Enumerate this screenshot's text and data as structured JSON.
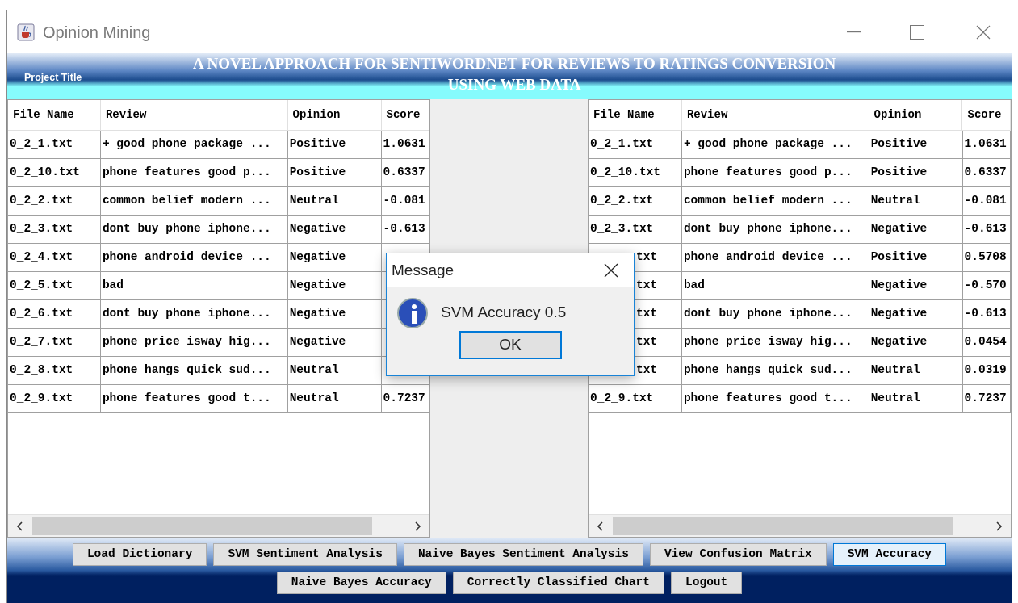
{
  "window": {
    "title": "Opinion Mining"
  },
  "header": {
    "label": "Project Title",
    "title_lines": [
      "A NOVEL APPROACH FOR SENTIWORDNET FOR REVIEWS TO RATINGS CONVERSION",
      "USING WEB DATA"
    ]
  },
  "tables": [
    {
      "columns": [
        "File Name",
        "Review",
        "Opinion",
        "Score"
      ],
      "rows": [
        {
          "file_name": "0_2_1.txt",
          "review": "+ good phone package ...",
          "opinion": "Positive",
          "score": "1.0631",
          "covered": false
        },
        {
          "file_name": "0_2_10.txt",
          "review": "phone features good p...",
          "opinion": "Positive",
          "score": "0.6337",
          "covered": false
        },
        {
          "file_name": "0_2_2.txt",
          "review": "common belief modern ...",
          "opinion": "Neutral",
          "score": "-0.081",
          "covered": false
        },
        {
          "file_name": "0_2_3.txt",
          "review": "dont buy phone iphone...",
          "opinion": "Negative",
          "score": "-0.613",
          "covered": false
        },
        {
          "file_name": "0_2_4.txt",
          "review": "phone android device ...",
          "opinion": "Negative",
          "covered": false
        },
        {
          "file_name": "0_2_5.txt",
          "review": "bad",
          "opinion": "Negative",
          "covered": false
        },
        {
          "file_name": "0_2_6.txt",
          "review": "dont buy phone iphone...",
          "opinion": "Negative",
          "covered": false
        },
        {
          "file_name": "0_2_7.txt",
          "review": "phone price isway hig...",
          "opinion": "Negative",
          "covered": false
        },
        {
          "file_name": "0_2_8.txt",
          "review": "phone hangs quick sud...",
          "opinion": "Neutral",
          "covered": false
        },
        {
          "file_name": "0_2_9.txt",
          "review": "phone features good t...",
          "opinion": "Neutral",
          "score": "0.7237",
          "covered": false
        }
      ]
    },
    {
      "columns": [
        "File Name",
        "Review",
        "Opinion",
        "Score"
      ],
      "rows": [
        {
          "file_name": "0_2_1.txt",
          "review": "+ good phone package ...",
          "opinion": "Positive",
          "score": "1.0631",
          "covered": false
        },
        {
          "file_name": "0_2_10.txt",
          "review": "phone features good p...",
          "opinion": "Positive",
          "score": "0.6337",
          "covered": false
        },
        {
          "file_name": "0_2_2.txt",
          "review": "common belief modern ...",
          "opinion": "Neutral",
          "score": "-0.081",
          "covered": false
        },
        {
          "file_name": "0_2_3.txt",
          "review": "dont buy phone iphone...",
          "opinion": "Negative",
          "score": "-0.613",
          "covered": false
        },
        {
          "file_name": "txt",
          "review": "phone android device ...",
          "opinion": "Positive",
          "score": "0.5708",
          "covered": true
        },
        {
          "file_name": "txt",
          "review": "bad",
          "opinion": "Negative",
          "score": "-0.570",
          "covered": true
        },
        {
          "file_name": "txt",
          "review": "dont buy phone iphone...",
          "opinion": "Negative",
          "score": "-0.613",
          "covered": true
        },
        {
          "file_name": "txt",
          "review": "phone price isway hig...",
          "opinion": "Negative",
          "score": "0.0454",
          "covered": true
        },
        {
          "file_name": "txt",
          "review": "phone hangs quick sud...",
          "opinion": "Neutral",
          "score": "0.0319",
          "covered": true
        },
        {
          "file_name": "0_2_9.txt",
          "review": "phone features good t...",
          "opinion": "Neutral",
          "score": "0.7237",
          "covered": false
        }
      ]
    }
  ],
  "buttons": [
    {
      "label": "Load Dictionary",
      "selected": false
    },
    {
      "label": "SVM Sentiment Analysis",
      "selected": false
    },
    {
      "label": "Naive Bayes Sentiment Analysis",
      "selected": false
    },
    {
      "label": "View Confusion Matrix",
      "selected": false
    },
    {
      "label": "SVM Accuracy",
      "selected": true
    },
    {
      "label": "Naive Bayes Accuracy",
      "selected": false
    },
    {
      "label": "Correctly Classified Chart",
      "selected": false
    },
    {
      "label": "Logout",
      "selected": false
    }
  ],
  "dialog": {
    "title": "Message",
    "message": "SVM Accuracy 0.5",
    "button": "OK"
  }
}
